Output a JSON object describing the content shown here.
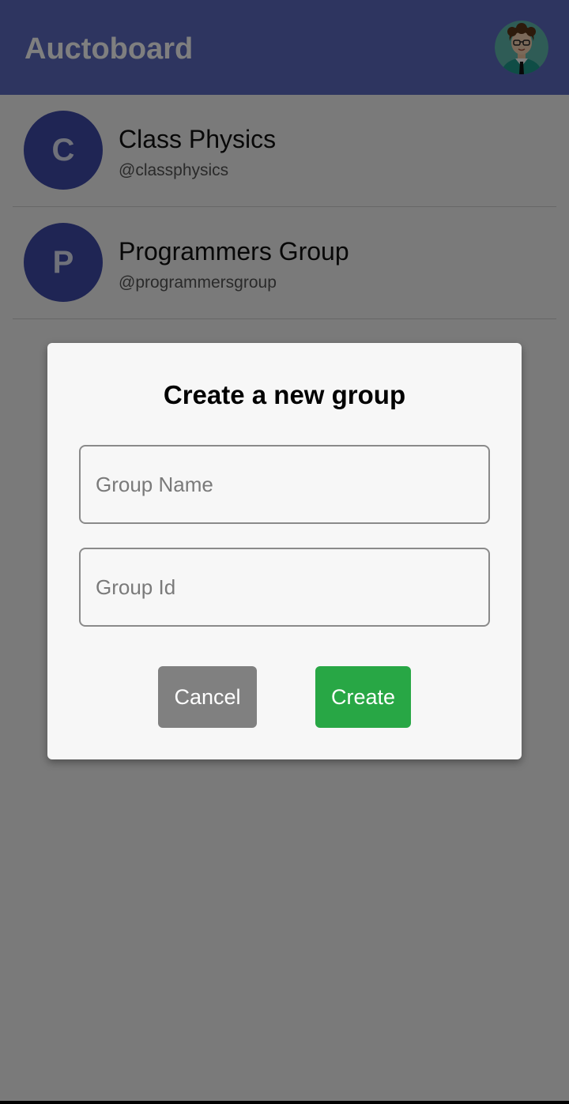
{
  "appbar": {
    "title": "Auctoboard",
    "profile_icon": "user-avatar-icon",
    "color": "#5c6bc0"
  },
  "groups": [
    {
      "initial": "C",
      "name": "Class Physics",
      "handle": "@classphysics"
    },
    {
      "initial": "P",
      "name": "Programmers Group",
      "handle": "@programmersgroup"
    }
  ],
  "dialog": {
    "title": "Create a new group",
    "group_name_placeholder": "Group Name",
    "group_id_placeholder": "Group Id",
    "cancel_label": "Cancel",
    "create_label": "Create"
  },
  "colors": {
    "avatar": "#3f4aa8",
    "cancel": "#808080",
    "create": "#28a745"
  }
}
